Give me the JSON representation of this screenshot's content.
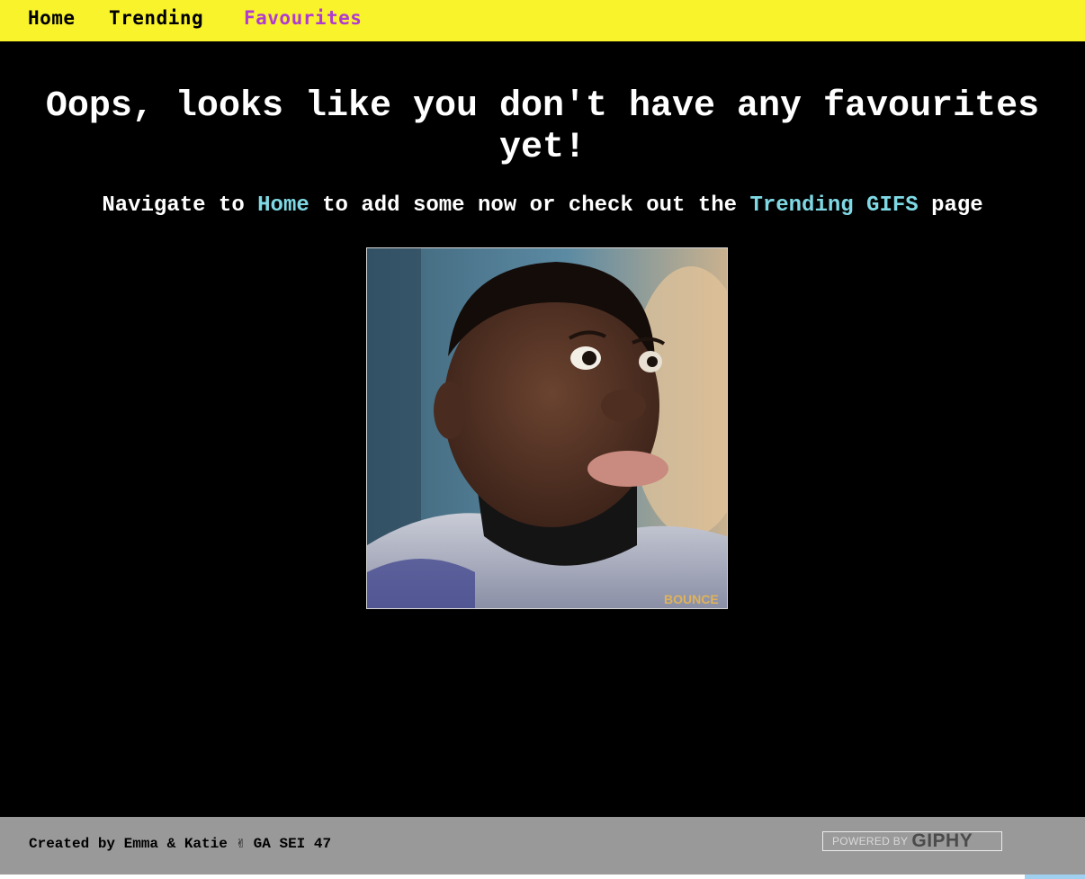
{
  "nav": {
    "home": "Home",
    "trending": "Trending",
    "favourites": "Favourites"
  },
  "main": {
    "heading": "Oops, looks like you don't have any favourites yet!",
    "sub_prefix": "Navigate to ",
    "sub_home_link": "Home",
    "sub_middle": " to add some now or check out the ",
    "sub_trending_link": "Trending GIFS",
    "sub_suffix": " page",
    "gif_watermark": "BOUNCE"
  },
  "footer": {
    "credit": "Created by Emma & Katie ✌ GA SEI 47",
    "giphy_small": "POWERED BY",
    "giphy_big": "GIPHY"
  },
  "colors": {
    "navbar": "#f9f32c",
    "active_nav": "#b03bd0",
    "link": "#7fd9e4",
    "footer": "#999999"
  }
}
